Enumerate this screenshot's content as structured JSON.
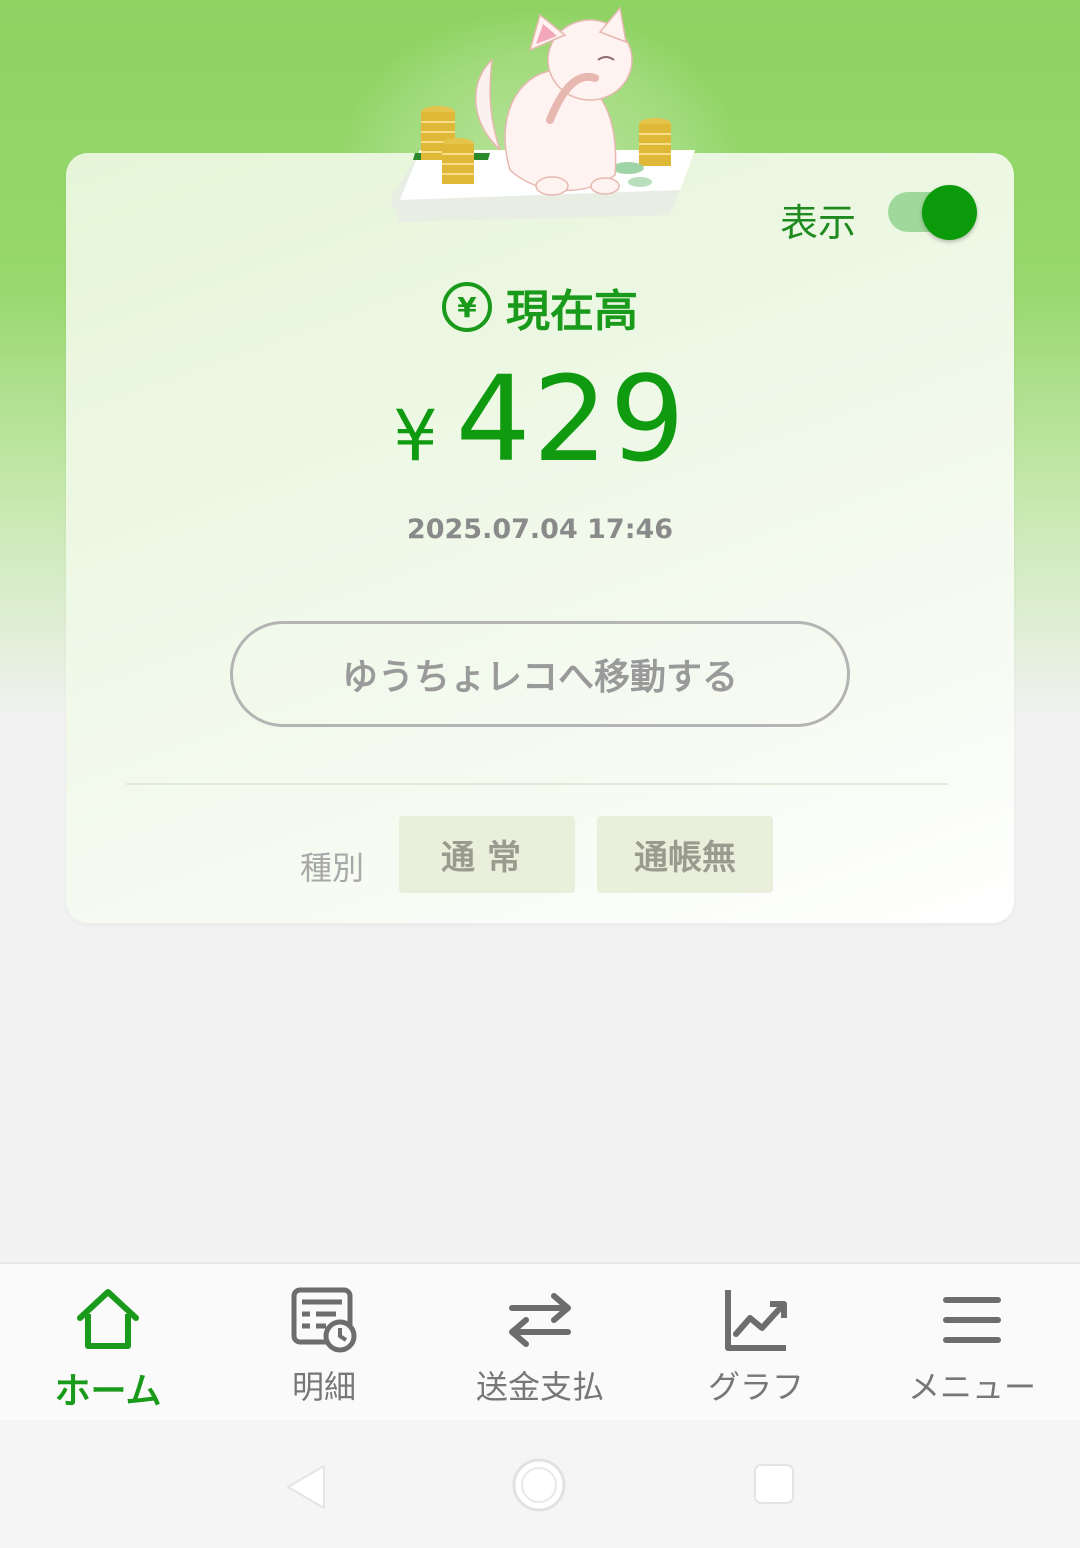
{
  "header": {
    "toggle_label": "表示",
    "toggle_on": true
  },
  "balance": {
    "icon": "yen-circle-icon",
    "yen_glyph": "¥",
    "label": "現在高",
    "currency_symbol": "¥",
    "amount": "429",
    "timestamp": "2025.07.04 17:46"
  },
  "actions": {
    "move_button": "ゆうちょレコへ移動する"
  },
  "account_type": {
    "label": "種別",
    "chips": [
      "通常",
      "通帳無"
    ]
  },
  "bottom_nav": {
    "items": [
      {
        "label": "ホーム",
        "icon": "home-icon",
        "active": true
      },
      {
        "label": "明細",
        "icon": "statement-icon",
        "active": false
      },
      {
        "label": "送金支払",
        "icon": "transfer-icon",
        "active": false
      },
      {
        "label": "グラフ",
        "icon": "chart-icon",
        "active": false
      },
      {
        "label": "メニュー",
        "icon": "menu-icon",
        "active": false
      }
    ]
  },
  "colors": {
    "brand_green": "#1a9a1a",
    "header_green": "#8fd363"
  }
}
